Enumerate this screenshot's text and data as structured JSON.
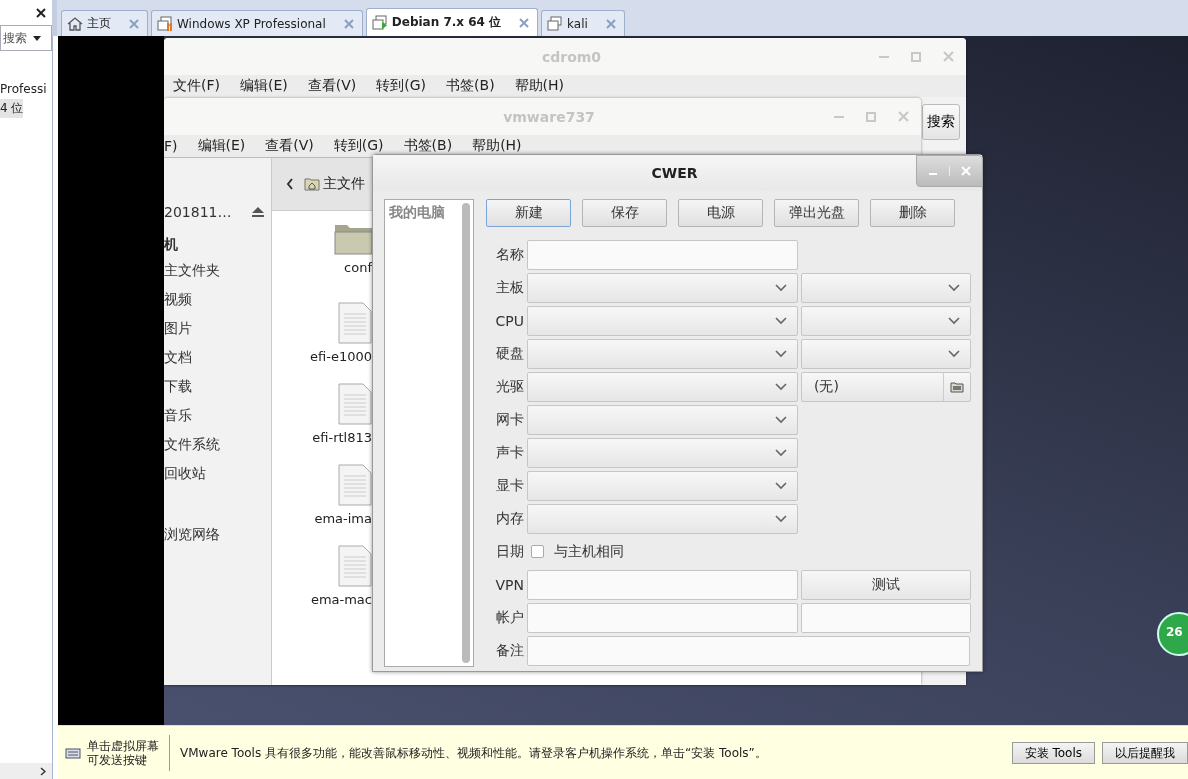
{
  "vm_library": {
    "search": "搜索",
    "items": [
      {
        "label": "Professi",
        "selected": false
      },
      {
        "label": "4 位",
        "selected": true
      }
    ]
  },
  "tabs": [
    {
      "label": "主页",
      "kind": "home",
      "selected": false
    },
    {
      "label": "Windows XP Professional",
      "kind": "paused",
      "selected": false
    },
    {
      "label": "Debian 7.x 64 位",
      "kind": "running",
      "selected": true
    },
    {
      "label": "kali",
      "kind": "stopped",
      "selected": false
    }
  ],
  "back_window": {
    "title": "cdrom0",
    "menu": [
      "文件(F)",
      "编辑(E)",
      "查看(V)",
      "转到(G)",
      "书签(B)",
      "帮助(H)"
    ],
    "search_button": "搜索"
  },
  "front_window": {
    "title": "vmware737",
    "menu": [
      "F)",
      "编辑(E)",
      "查看(V)",
      "转到(G)",
      "书签(B)",
      "帮助(H)"
    ],
    "device": "201811…",
    "groups": [
      {
        "header": "机",
        "items": [
          "主文件夹",
          "视频",
          "图片",
          "文档",
          "下载",
          "音乐",
          "文件系统",
          "回收站"
        ]
      },
      {
        "items": [
          "浏览网络"
        ]
      }
    ],
    "path": "主文件",
    "files": [
      {
        "name": "conf",
        "kind": "folder"
      },
      {
        "name": "efi-e1000",
        "kind": "file"
      },
      {
        "name": "efi-rtl813",
        "kind": "file"
      },
      {
        "name": "ema-ima",
        "kind": "file"
      },
      {
        "name": "ema-mac",
        "kind": "file"
      }
    ]
  },
  "dialog": {
    "title": "CWER",
    "list_items": [
      "我的电脑"
    ],
    "buttons": [
      {
        "label": "新建",
        "focused": true
      },
      {
        "label": "保存",
        "focused": false
      },
      {
        "label": "电源",
        "focused": false
      },
      {
        "label": "弹出光盘",
        "focused": false
      },
      {
        "label": "删除",
        "focused": false
      }
    ],
    "form": [
      {
        "label": "名称",
        "fields": [
          {
            "kind": "text"
          }
        ]
      },
      {
        "label": "主板",
        "fields": [
          {
            "kind": "combo"
          },
          {
            "kind": "combo"
          }
        ]
      },
      {
        "label": "CPU",
        "fields": [
          {
            "kind": "combo"
          },
          {
            "kind": "combo"
          }
        ]
      },
      {
        "label": "硬盘",
        "fields": [
          {
            "kind": "combo"
          },
          {
            "kind": "combo"
          }
        ]
      },
      {
        "label": "光驱",
        "fields": [
          {
            "kind": "combo"
          },
          {
            "kind": "file",
            "value": "(无)"
          }
        ]
      },
      {
        "label": "网卡",
        "fields": [
          {
            "kind": "combo"
          }
        ]
      },
      {
        "label": "声卡",
        "fields": [
          {
            "kind": "combo"
          }
        ]
      },
      {
        "label": "显卡",
        "fields": [
          {
            "kind": "combo"
          }
        ]
      },
      {
        "label": "内存",
        "fields": [
          {
            "kind": "combo"
          }
        ]
      },
      {
        "label": "日期",
        "fields": [
          {
            "kind": "checkbox",
            "checked": false,
            "label": "与主机相同"
          }
        ]
      },
      {
        "label": "VPN",
        "fields": [
          {
            "kind": "text"
          },
          {
            "kind": "button",
            "label": "测试"
          }
        ]
      },
      {
        "label": "帐户",
        "fields": [
          {
            "kind": "text"
          },
          {
            "kind": "text"
          }
        ]
      },
      {
        "label": "备注",
        "fields": [
          {
            "kind": "wide"
          }
        ]
      }
    ]
  },
  "hint_bar": {
    "click_hint": [
      "单击虚拟屏幕",
      "可发送按键"
    ],
    "message": "VMware Tools 具有很多功能，能改善鼠标移动性、视频和性能。请登录客户机操作系统，单击“安装 Tools”。",
    "buttons": [
      "安装 Tools",
      "以后提醒我"
    ]
  },
  "badge": "26"
}
